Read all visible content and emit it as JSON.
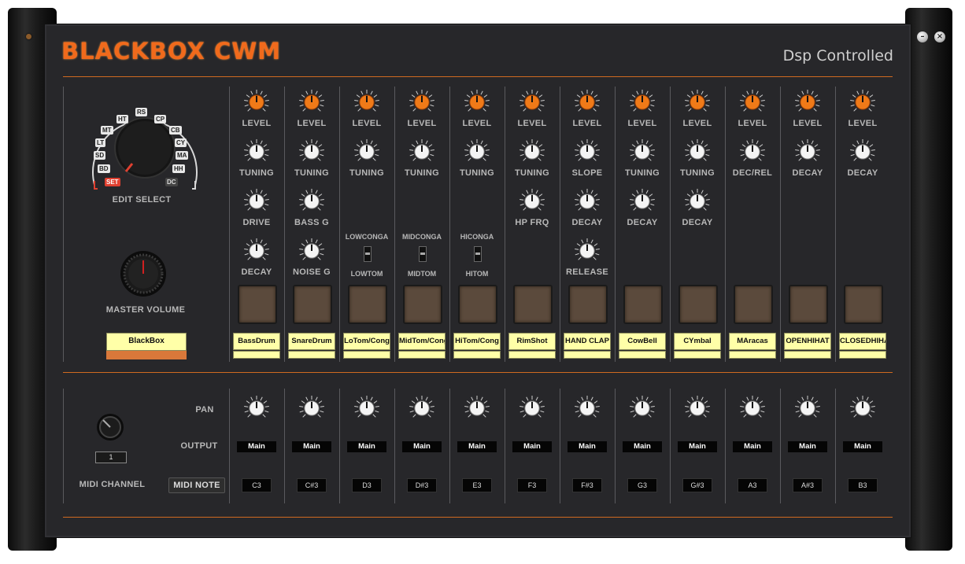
{
  "header": {
    "title": "BLACKBOX CWM",
    "subtitle": "Dsp Controlled"
  },
  "window": {
    "min_glyph": "–",
    "close_glyph": "×"
  },
  "colors": {
    "accent": "#f06a1c",
    "panel": "#27272a",
    "name_field": "#ffffa8",
    "pad": "#5b4a3c"
  },
  "edit_select": {
    "label": "EDIT SELECT",
    "items": [
      "HT",
      "RS",
      "CP",
      "MT",
      "CB",
      "LT",
      "CY",
      "SD",
      "MA",
      "BD",
      "HH",
      "SET",
      "DC"
    ],
    "active": "SET"
  },
  "master": {
    "label": "MASTER VOLUME",
    "preset_name": "BlackBox"
  },
  "channels": [
    {
      "name": "BassDrum",
      "knobs": [
        "LEVEL",
        "TUNING",
        "DRIVE",
        "DECAY"
      ],
      "switch": null
    },
    {
      "name": "SnareDrum",
      "knobs": [
        "LEVEL",
        "TUNING",
        "BASS G",
        "NOISE G"
      ],
      "switch": null
    },
    {
      "name": "LoTom/Cong",
      "knobs": [
        "LEVEL",
        "TUNING"
      ],
      "switch": {
        "top": "LOWCONGA",
        "bottom": "LOWTOM"
      }
    },
    {
      "name": "MidTom/Cong",
      "knobs": [
        "LEVEL",
        "TUNING"
      ],
      "switch": {
        "top": "MIDCONGA",
        "bottom": "MIDTOM"
      }
    },
    {
      "name": "HiTom/Cong",
      "knobs": [
        "LEVEL",
        "TUNING"
      ],
      "switch": {
        "top": "HICONGA",
        "bottom": "HITOM"
      }
    },
    {
      "name": "RimShot",
      "knobs": [
        "LEVEL",
        "TUNING",
        "HP FRQ"
      ],
      "switch": null
    },
    {
      "name": "HAND CLAP",
      "knobs": [
        "LEVEL",
        "SLOPE",
        "DECAY",
        "RELEASE"
      ],
      "switch": null
    },
    {
      "name": "CowBell",
      "knobs": [
        "LEVEL",
        "TUNING",
        "DECAY"
      ],
      "switch": null
    },
    {
      "name": "CYmbal",
      "knobs": [
        "LEVEL",
        "TUNING",
        "DECAY"
      ],
      "switch": null
    },
    {
      "name": "MAracas",
      "knobs": [
        "LEVEL",
        "DEC/REL"
      ],
      "switch": null
    },
    {
      "name": "OPENHIHAT",
      "knobs": [
        "LEVEL",
        "DECAY"
      ],
      "switch": null
    },
    {
      "name": "CLOSEDHIHAT",
      "knobs": [
        "LEVEL",
        "DECAY"
      ],
      "switch": null
    }
  ],
  "mixer": {
    "pan_label": "PAN",
    "output_label": "OUTPUT",
    "midi_channel_label": "MIDI CHANNEL",
    "midi_channel_value": "1",
    "midi_note_label": "MIDI NOTE",
    "outputs": [
      "Main",
      "Main",
      "Main",
      "Main",
      "Main",
      "Main",
      "Main",
      "Main",
      "Main",
      "Main",
      "Main",
      "Main"
    ],
    "notes": [
      "C3",
      "C#3",
      "D3",
      "D#3",
      "E3",
      "F3",
      "F#3",
      "G3",
      "G#3",
      "A3",
      "A#3",
      "B3"
    ]
  }
}
